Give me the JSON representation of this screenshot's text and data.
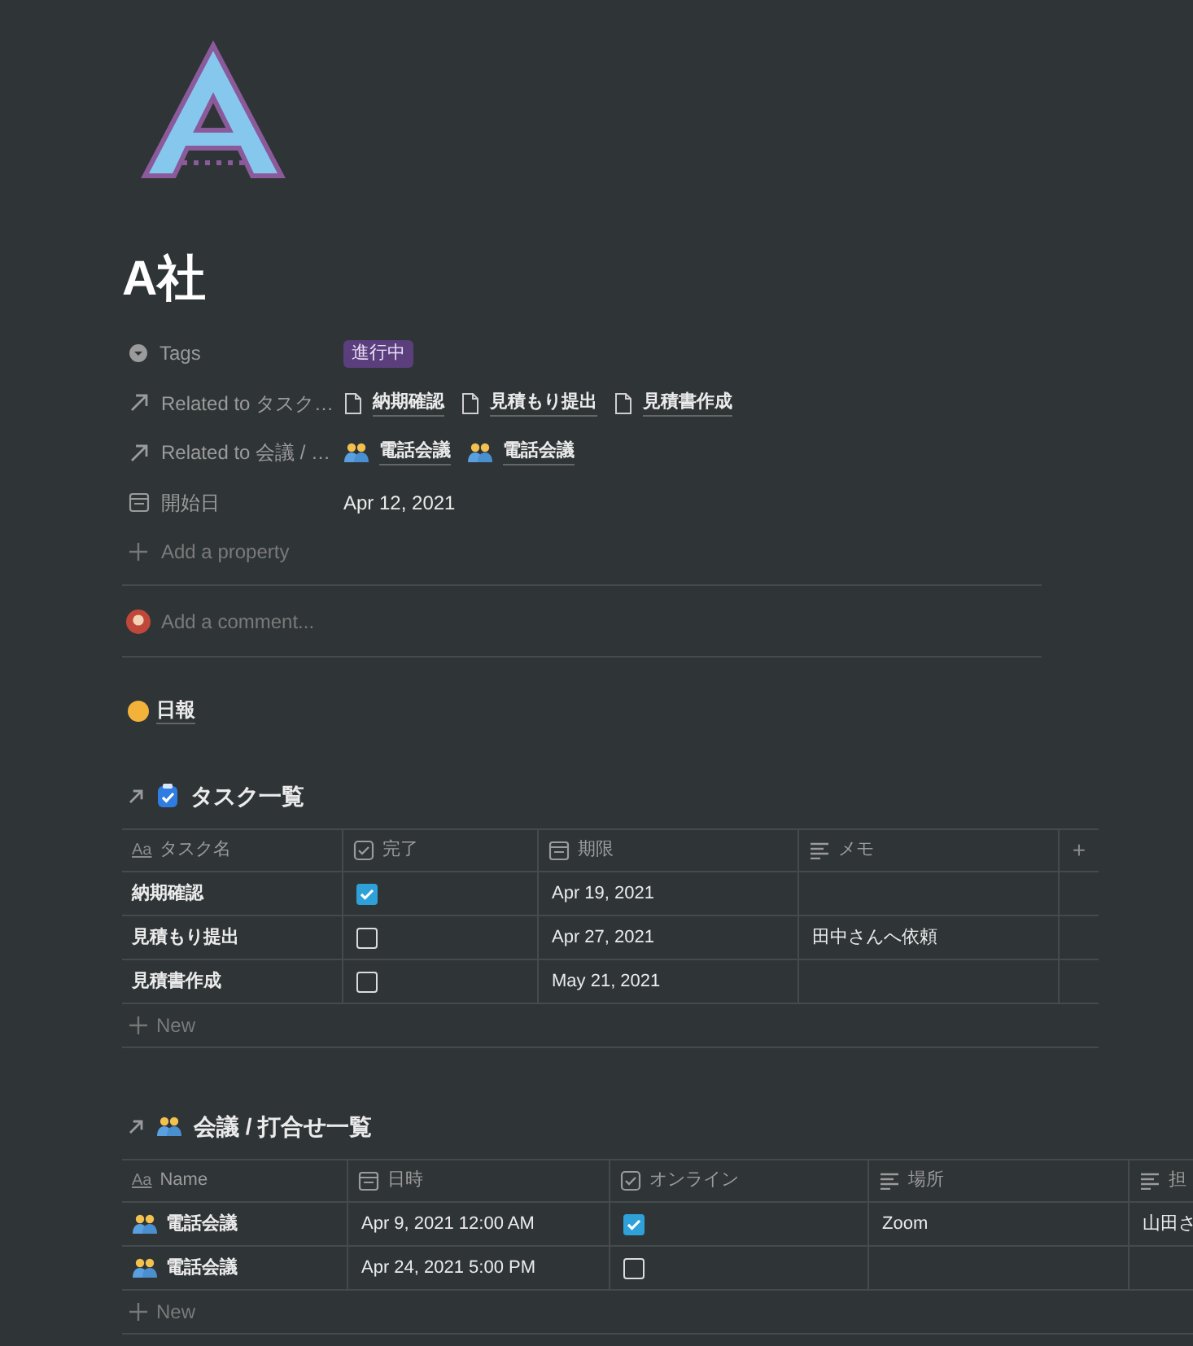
{
  "page": {
    "title": "A社",
    "properties": [
      {
        "kind": "select",
        "label": "Tags",
        "tags": [
          {
            "text": "進行中",
            "color": "#5b3f7d"
          }
        ]
      },
      {
        "kind": "relation",
        "label": "Related to タスク…",
        "items": [
          {
            "text": "納期確認",
            "kind": "page"
          },
          {
            "text": "見積もり提出",
            "kind": "page"
          },
          {
            "text": "見積書作成",
            "kind": "page"
          }
        ]
      },
      {
        "kind": "relation",
        "label": "Related to 会議 / …",
        "items": [
          {
            "text": "電話会議",
            "kind": "people"
          },
          {
            "text": "電話会議",
            "kind": "people"
          }
        ]
      },
      {
        "kind": "date",
        "label": "開始日",
        "value": "Apr 12, 2021"
      }
    ],
    "add_property": "Add a property",
    "comment": {
      "placeholder": "Add a comment..."
    },
    "links": [
      {
        "text": "日報"
      }
    ],
    "databases": [
      {
        "title": "タスク一覧",
        "kind": "checklist",
        "add_column": "+",
        "new_label": "New",
        "columns": [
          {
            "label": "タスク名",
            "kind": "title",
            "type_label": "Aa"
          },
          {
            "label": "完了",
            "kind": "checkbox"
          },
          {
            "label": "期限",
            "kind": "date"
          },
          {
            "label": "メモ",
            "kind": "text"
          }
        ],
        "rows": [
          {
            "cells": [
              {
                "text": "納期確認"
              },
              {
                "checked": true
              },
              {
                "text": "Apr 19, 2021"
              },
              null
            ]
          },
          {
            "cells": [
              {
                "text": "見積もり提出"
              },
              {
                "checked": false
              },
              {
                "text": "Apr 27, 2021"
              },
              {
                "text": "田中さんへ依頼"
              }
            ]
          },
          {
            "cells": [
              {
                "text": "見積書作成"
              },
              {
                "checked": false
              },
              {
                "text": "May 21, 2021"
              },
              null
            ]
          }
        ]
      },
      {
        "title": "会議 / 打合せ一覧",
        "kind": "people",
        "new_label": "New",
        "columns": [
          {
            "label": "Name",
            "kind": "title",
            "type_label": "Aa"
          },
          {
            "label": "日時",
            "kind": "date"
          },
          {
            "label": "オンライン",
            "kind": "checkbox"
          },
          {
            "label": "場所",
            "kind": "text"
          },
          {
            "label": "担",
            "kind": "text"
          }
        ],
        "rows": [
          {
            "cells": [
              {
                "text": "電話会議",
                "kind": "people"
              },
              {
                "text": "Apr 9, 2021 12:00 AM"
              },
              {
                "checked": true
              },
              {
                "text": "Zoom"
              },
              {
                "text": "山田さ"
              }
            ]
          },
          {
            "cells": [
              {
                "text": "電話会議",
                "kind": "people"
              },
              {
                "text": "Apr 24, 2021 5:00 PM"
              },
              {
                "checked": false
              },
              null,
              null
            ]
          }
        ]
      }
    ]
  }
}
